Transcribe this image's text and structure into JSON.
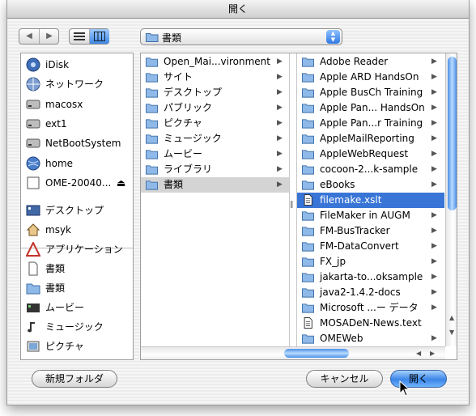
{
  "window": {
    "title": "開く"
  },
  "toolbar": {
    "back_icon": "back-arrow-icon",
    "forward_icon": "forward-arrow-icon",
    "list_view_icon": "list-view-icon",
    "column_view_icon": "column-view-icon",
    "location": "書類"
  },
  "sidebar": {
    "devices": [
      {
        "label": "iDisk",
        "icon": "idisk-icon"
      },
      {
        "label": "ネットワーク",
        "icon": "network-icon"
      },
      {
        "label": "macosx",
        "icon": "harddisk-icon"
      },
      {
        "label": "ext1",
        "icon": "harddisk-icon"
      },
      {
        "label": "NetBootSystem",
        "icon": "harddisk-icon"
      },
      {
        "label": "home",
        "icon": "globe-icon"
      },
      {
        "label": "OME-20040...",
        "icon": "disk-image-icon",
        "eject": "⏏"
      }
    ],
    "places": [
      {
        "label": "デスクトップ",
        "icon": "desktop-icon"
      },
      {
        "label": "msyk",
        "icon": "home-icon"
      },
      {
        "label": "アプリケーション",
        "icon": "applications-icon"
      },
      {
        "label": "書類",
        "icon": "document-icon"
      },
      {
        "label": "書類",
        "icon": "folder-icon"
      },
      {
        "label": "ムービー",
        "icon": "movie-icon"
      },
      {
        "label": "ミュージック",
        "icon": "music-icon"
      },
      {
        "label": "ピクチャ",
        "icon": "pictures-icon"
      }
    ]
  },
  "column1": [
    {
      "label": "Open_Mai...vironment"
    },
    {
      "label": "サイト"
    },
    {
      "label": "デスクトップ"
    },
    {
      "label": "パブリック"
    },
    {
      "label": "ピクチャ"
    },
    {
      "label": "ミュージック"
    },
    {
      "label": "ムービー"
    },
    {
      "label": "ライブラリ"
    },
    {
      "label": "書類",
      "selected": true
    }
  ],
  "column2": [
    {
      "label": "Adobe Reader",
      "kind": "folder"
    },
    {
      "label": "Apple ARD HandsOn",
      "kind": "folder"
    },
    {
      "label": "Apple BusCh Training",
      "kind": "folder"
    },
    {
      "label": "Apple Pan... HandsOn",
      "kind": "folder"
    },
    {
      "label": "Apple Pan...r Training",
      "kind": "folder"
    },
    {
      "label": "AppleMailReporting",
      "kind": "folder"
    },
    {
      "label": "AppleWebRequest",
      "kind": "folder"
    },
    {
      "label": "cocoon-2...k-sample",
      "kind": "folder"
    },
    {
      "label": "eBooks",
      "kind": "folder"
    },
    {
      "label": "filemake.xslt",
      "kind": "file",
      "selected": true
    },
    {
      "label": "FileMaker in AUGM",
      "kind": "folder"
    },
    {
      "label": "FM-BusTracker",
      "kind": "folder"
    },
    {
      "label": "FM-DataConvert",
      "kind": "folder"
    },
    {
      "label": "FX_jp",
      "kind": "folder"
    },
    {
      "label": "jakarta-to...oksample",
      "kind": "folder"
    },
    {
      "label": "java2-1.4.2-docs",
      "kind": "folder"
    },
    {
      "label": "Microsoft ...ー データ",
      "kind": "folder"
    },
    {
      "label": "MOSADeN-News.text",
      "kind": "file"
    },
    {
      "label": "OMEWeb",
      "kind": "folder"
    }
  ],
  "buttons": {
    "new_folder": "新規フォルダ",
    "cancel": "キャンセル",
    "open": "開く"
  },
  "colors": {
    "selection_blue": "#3875d7",
    "selection_grey": "#d4d4d4",
    "aqua_blue": "#3b85e6"
  }
}
